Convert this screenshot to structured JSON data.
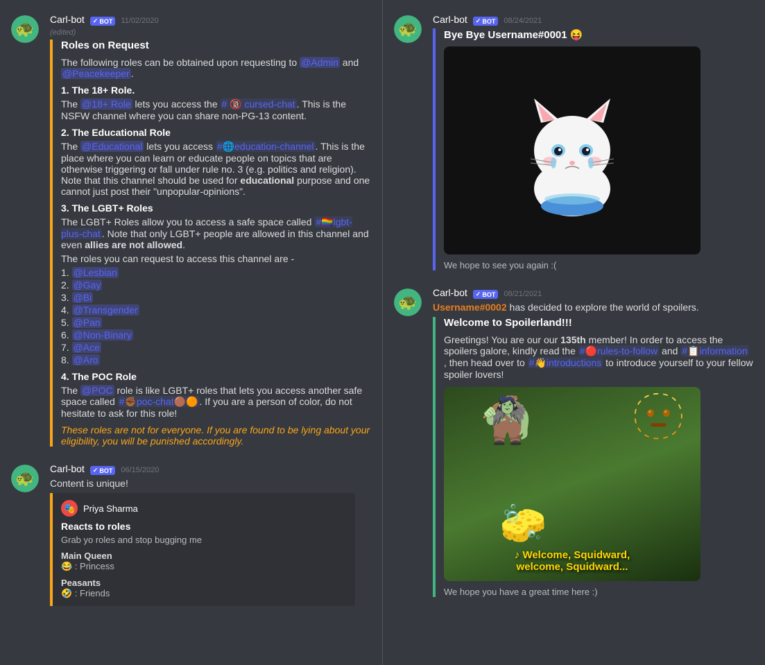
{
  "left_panel": {
    "messages": [
      {
        "id": "msg1",
        "username": "Carl-bot",
        "is_bot": true,
        "timestamp": "11/02/2020",
        "edited": true,
        "has_yellow_border": true,
        "content": {
          "title": "Roles on Request",
          "intro": "The following roles can be obtained upon requesting to",
          "mentions": [
            "@Admin",
            "@Peacekeeper"
          ],
          "sections": [
            {
              "heading": "1. The 18+ Role.",
              "text": "The @18+ Role lets you access the # 🔞 cursed-chat. This is the NSFW channel where you can share non-PG-13 content."
            },
            {
              "heading": "2. The Educational Role",
              "text": "The @Educational lets you access #🌐education-channel. This is the place where you can learn or educate people on topics that are otherwise triggering or fall under rule no. 3 (e.g. politics and religion). Note that this channel should be used for educational purpose and one cannot just post their \"unpopular-opinions\"."
            },
            {
              "heading": "3. The LGBT+ Roles",
              "text": "The LGBT+ Roles allow you to access a safe space called #🏳️‍🌈lgbt-plus-chat. Note that only LGBT+ people are allowed in this channel and even allies are not allowed.",
              "list_intro": "The roles you can request to access this channel are -",
              "list": [
                "@Lesbian",
                "@Gay",
                "@Bi",
                "@Transgender",
                "@Pan",
                "@Non-Binary",
                "@Ace",
                "@Aro"
              ]
            },
            {
              "heading": "4. The POC Role",
              "text": "The @POC role is like LGBT+ roles that lets you access another safe space called #✊🏾poc-chat🟤🟠. If you are a person of color, do not hesitate to ask for this role!"
            }
          ],
          "warning": "These roles are not for everyone. If you are found to be lying about your eligibility, you will be punished accordingly."
        }
      },
      {
        "id": "msg2",
        "username": "Carl-bot",
        "is_bot": true,
        "timestamp": "06/15/2020",
        "text": "Content is unique!",
        "embed": {
          "author_name": "Priya Sharma",
          "title": "Reacts to roles",
          "description": "Grab yo roles and stop bugging me",
          "fields": [
            {
              "name": "Main Queen",
              "value": "😂 : Princess"
            },
            {
              "name": "Peasants",
              "value": "🤣 : Friends"
            }
          ]
        }
      }
    ]
  },
  "right_panel": {
    "messages": [
      {
        "id": "rmsg1",
        "username": "Carl-bot",
        "is_bot": true,
        "timestamp": "08/24/2021",
        "title": "Bye Bye Username#0001 😝",
        "image_type": "cat",
        "caption": "We hope to see you again :("
      },
      {
        "id": "rmsg2",
        "username": "Carl-bot",
        "is_bot": true,
        "timestamp": "08/21/2021",
        "spoiler_user": "Username#0002",
        "spoiler_text": "has decided to explore the world of spoilers.",
        "welcome_title": "Welcome to Spoilerland!!!",
        "welcome_text_1": "Greetings! You are our",
        "member_count": "135th",
        "welcome_text_2": "member! In order to access the spoilers galore, kindly read the",
        "channel1": "#🔴rules-to-follow",
        "welcome_text_3": "and",
        "channel2": "#📋information",
        "welcome_text_4": ", then head over to",
        "channel3": "#👋introductions",
        "welcome_text_5": "to introduce yourself to your fellow spoiler lovers!",
        "image_type": "spongebob",
        "spongebob_text1": "♪ Welcome, Squidward,",
        "spongebob_text2": "welcome, Squidward...",
        "caption": "We hope you have a great time here :)"
      }
    ]
  },
  "ui": {
    "bot_badge": "BOT",
    "check_icon": "✓"
  }
}
